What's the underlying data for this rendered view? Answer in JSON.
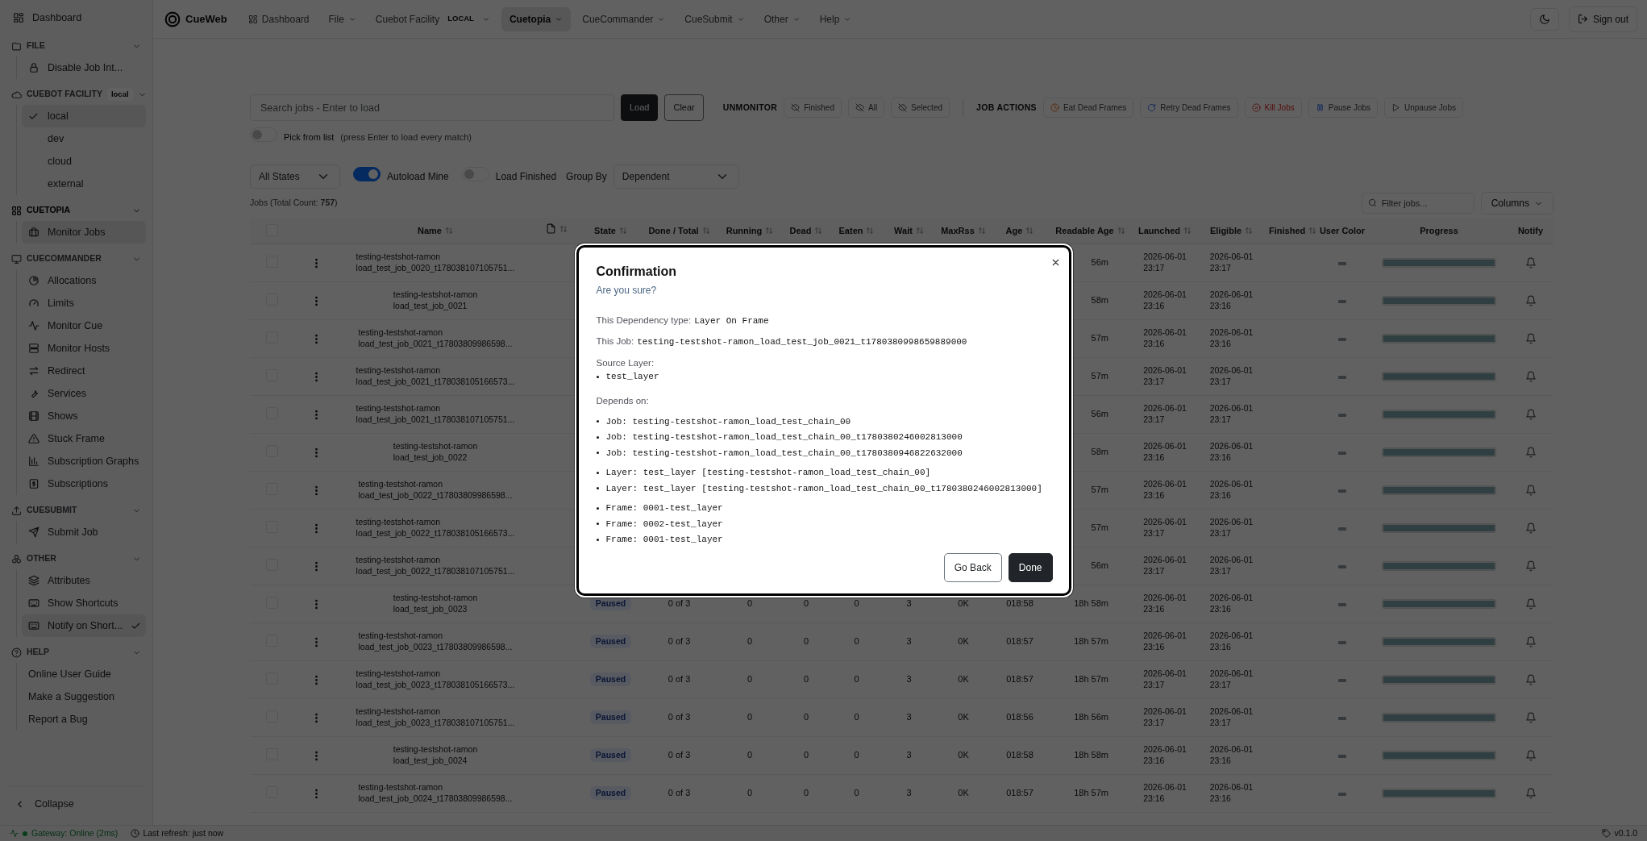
{
  "topbar": {
    "brand": "CueWeb",
    "nav": [
      {
        "label": "Dashboard",
        "kind": "link",
        "selected": false
      },
      {
        "label": "File",
        "kind": "menu",
        "selected": false
      },
      {
        "label": "Cuebot Facility",
        "badge": "LOCAL",
        "kind": "menu",
        "selected": false
      },
      {
        "label": "Cuetopia",
        "kind": "menu",
        "selected": true
      },
      {
        "label": "CueCommander",
        "kind": "menu",
        "selected": false
      },
      {
        "label": "CueSubmit",
        "kind": "menu",
        "selected": false
      },
      {
        "label": "Other",
        "kind": "menu",
        "selected": false
      },
      {
        "label": "Help",
        "kind": "menu",
        "selected": false
      }
    ],
    "sign_out": "Sign out"
  },
  "sidebar": {
    "dashboard": "Dashboard",
    "sections": [
      {
        "title": "FILE",
        "expanded": true,
        "active": false,
        "items": [
          {
            "label": "Disable Job Int...",
            "selected": false
          }
        ]
      },
      {
        "title": "CUEBOT FACILITY",
        "badge": "local",
        "expanded": true,
        "active": false,
        "items": [
          {
            "label": "local",
            "selected": true,
            "checked": true
          },
          {
            "label": "dev",
            "selected": false,
            "checked": false
          },
          {
            "label": "cloud",
            "selected": false,
            "checked": false
          },
          {
            "label": "external",
            "selected": false,
            "checked": false
          }
        ]
      },
      {
        "title": "CUETOPIA",
        "expanded": true,
        "active": true,
        "items": [
          {
            "label": "Monitor Jobs",
            "selected": true
          }
        ]
      },
      {
        "title": "CUECOMMANDER",
        "expanded": true,
        "active": false,
        "items": [
          {
            "label": "Allocations",
            "selected": false
          },
          {
            "label": "Limits",
            "selected": false
          },
          {
            "label": "Monitor Cue",
            "selected": false
          },
          {
            "label": "Monitor Hosts",
            "selected": false
          },
          {
            "label": "Redirect",
            "selected": false
          },
          {
            "label": "Services",
            "selected": false
          },
          {
            "label": "Shows",
            "selected": false
          },
          {
            "label": "Stuck Frame",
            "selected": false
          },
          {
            "label": "Subscription Graphs",
            "selected": false
          },
          {
            "label": "Subscriptions",
            "selected": false
          }
        ]
      },
      {
        "title": "CUESUBMIT",
        "expanded": true,
        "active": false,
        "items": [
          {
            "label": "Submit Job",
            "selected": false
          }
        ]
      },
      {
        "title": "OTHER",
        "expanded": true,
        "active": false,
        "items": [
          {
            "label": "Attributes",
            "selected": false
          },
          {
            "label": "Show Shortcuts",
            "selected": false
          },
          {
            "label": "Notify on Short...",
            "selected": true,
            "checked": true
          }
        ]
      },
      {
        "title": "HELP",
        "expanded": true,
        "active": false,
        "items": [
          {
            "label": "Online User Guide",
            "selected": false
          },
          {
            "label": "Make a Suggestion",
            "selected": false
          },
          {
            "label": "Report a Bug",
            "selected": false
          }
        ]
      }
    ],
    "collapse": "Collapse"
  },
  "toolbar": {
    "search_placeholder": "Search jobs - Enter to load",
    "load": "Load",
    "clear": "Clear",
    "unmonitor_label": "UNMONITOR",
    "unmonitor": [
      "Finished",
      "All",
      "Selected"
    ],
    "actions_label": "JOB ACTIONS",
    "actions": [
      {
        "label": "Eat Dead Frames",
        "kind": "eat"
      },
      {
        "label": "Retry Dead Frames",
        "kind": "retry"
      },
      {
        "label": "Kill Jobs",
        "kind": "kill"
      },
      {
        "label": "Pause Jobs",
        "kind": "pause"
      },
      {
        "label": "Unpause Jobs",
        "kind": "unpause"
      }
    ],
    "pick_from_list": {
      "on": false,
      "label": "Pick from list",
      "hint": "(press Enter to load every match)"
    }
  },
  "filters": {
    "state": "All States",
    "autoload_mine": {
      "label": "Autoload Mine",
      "on": true
    },
    "load_finished": {
      "label": "Load Finished",
      "on": false
    },
    "group_by_label": "Group By",
    "group_by": "Dependent"
  },
  "jobs": {
    "count": "Jobs (Total Count: **757**)",
    "filter_placeholder": "Filter jobs...",
    "columns_button": "Columns"
  },
  "table": {
    "header_checked": false,
    "columns": [
      {
        "label": "Name",
        "sortable": true
      },
      {
        "kind": "icon",
        "sortable": true
      },
      {
        "label": "State",
        "sortable": true
      },
      {
        "label": "Done / Total",
        "sortable": true
      },
      {
        "label": "Running",
        "sortable": true
      },
      {
        "label": "Dead",
        "sortable": true
      },
      {
        "label": "Eaten",
        "sortable": true
      },
      {
        "label": "Wait",
        "sortable": true
      },
      {
        "label": "MaxRss",
        "sortable": true
      },
      {
        "label": "Age",
        "sortable": true
      },
      {
        "label": "Readable Age",
        "sortable": true
      },
      {
        "label": "Launched",
        "sortable": true
      },
      {
        "label": "Eligible",
        "sortable": true
      },
      {
        "label": "Finished",
        "sortable": true
      },
      {
        "label": "User Color",
        "sortable": false
      },
      {
        "label": "Progress",
        "sortable": false
      },
      {
        "label": "Notify",
        "sortable": false
      }
    ],
    "rows": [
      {
        "checked": false,
        "name": "testing-testshot-ramon\nload_test_job_0020_t178038107105751...",
        "readable_age": "56m",
        "launched": "2026-06-01\n23:17",
        "eligible": "2026-06-01\n23:17",
        "level": 1
      },
      {
        "checked": false,
        "name": "testing-testshot-ramon\nload_test_job_0021",
        "readable_age": "58m",
        "launched": "2026-06-01\n23:16",
        "eligible": "2026-06-01\n23:16",
        "level": 1
      },
      {
        "checked": false,
        "name": "testing-testshot-ramon\nload_test_job_0021_t17803809986598...",
        "readable_age": "57m",
        "launched": "2026-06-01\n23:16",
        "eligible": "2026-06-01\n23:16",
        "level": 1
      },
      {
        "checked": false,
        "name": "testing-testshot-ramon\nload_test_job_0021_t178038105166573...",
        "readable_age": "57m",
        "launched": "2026-06-01\n23:17",
        "eligible": "2026-06-01\n23:17",
        "level": 1
      },
      {
        "checked": false,
        "name": "testing-testshot-ramon\nload_test_job_0021_t178038107105751...",
        "readable_age": "56m",
        "launched": "2026-06-01\n23:17",
        "eligible": "2026-06-01\n23:17",
        "level": 1
      },
      {
        "checked": false,
        "name": "testing-testshot-ramon\nload_test_job_0022",
        "readable_age": "58m",
        "launched": "2026-06-01\n23:16",
        "eligible": "2026-06-01\n23:16",
        "level": 1
      },
      {
        "checked": false,
        "name": "testing-testshot-ramon\nload_test_job_0022_t17803809986598...",
        "readable_age": "57m",
        "launched": "2026-06-01\n23:16",
        "eligible": "2026-06-01\n23:16",
        "level": 1
      },
      {
        "checked": false,
        "name": "testing-testshot-ramon\nload_test_job_0022_t178038105166573...",
        "readable_age": "57m",
        "launched": "2026-06-01\n23:17",
        "eligible": "2026-06-01\n23:17",
        "level": 1
      },
      {
        "checked": false,
        "name": "testing-testshot-ramon\nload_test_job_0022_t178038107105751...",
        "readable_age": "56m",
        "launched": "2026-06-01\n23:17",
        "eligible": "2026-06-01\n23:17",
        "level": 1
      },
      {
        "checked": false,
        "name": "testing-testshot-ramon\nload_test_job_0023",
        "state": "Paused",
        "done": "0 of 3",
        "running": "0",
        "dead": "0",
        "eaten": "0",
        "wait": "3",
        "maxrss": "0K",
        "age": "018:58",
        "readable_age": "18h 58m",
        "launched": "2026-06-01\n23:16",
        "eligible": "2026-06-01\n23:16",
        "level": 1
      },
      {
        "checked": false,
        "name": "testing-testshot-ramon\nload_test_job_0023_t17803809986598...",
        "state": "Paused",
        "done": "0 of 3",
        "running": "0",
        "dead": "0",
        "eaten": "0",
        "wait": "3",
        "maxrss": "0K",
        "age": "018:57",
        "readable_age": "18h 57m",
        "launched": "2026-06-01\n23:16",
        "eligible": "2026-06-01\n23:16",
        "level": 1
      },
      {
        "checked": false,
        "name": "testing-testshot-ramon\nload_test_job_0023_t178038105166573...",
        "state": "Paused",
        "done": "0 of 3",
        "running": "0",
        "dead": "0",
        "eaten": "0",
        "wait": "3",
        "maxrss": "0K",
        "age": "018:57",
        "readable_age": "18h 57m",
        "launched": "2026-06-01\n23:17",
        "eligible": "2026-06-01\n23:17",
        "level": 1
      },
      {
        "checked": false,
        "name": "testing-testshot-ramon\nload_test_job_0023_t178038107105751...",
        "state": "Paused",
        "done": "0 of 3",
        "running": "0",
        "dead": "0",
        "eaten": "0",
        "wait": "3",
        "maxrss": "0K",
        "age": "018:56",
        "readable_age": "18h 56m",
        "launched": "2026-06-01\n23:17",
        "eligible": "2026-06-01\n23:17",
        "level": 1
      },
      {
        "checked": false,
        "name": "testing-testshot-ramon\nload_test_job_0024",
        "state": "Paused",
        "done": "0 of 3",
        "running": "0",
        "dead": "0",
        "eaten": "0",
        "wait": "3",
        "maxrss": "0K",
        "age": "018:58",
        "readable_age": "18h 58m",
        "launched": "2026-06-01\n23:16",
        "eligible": "2026-06-01\n23:16",
        "level": 1
      },
      {
        "checked": false,
        "name": "testing-testshot-ramon\nload_test_job_0024_t17803809986598...",
        "state": "Paused",
        "done": "0 of 3",
        "running": "0",
        "dead": "0",
        "eaten": "0",
        "wait": "3",
        "maxrss": "0K",
        "age": "018:57",
        "readable_age": "18h 57m",
        "launched": "2026-06-01\n23:16",
        "eligible": "2026-06-01\n23:16",
        "level": 1
      }
    ]
  },
  "status_bar": {
    "online": true,
    "gateway": "Gateway: Online (2ms)",
    "refresh": "Last refresh: just now",
    "version": "v0.1.0"
  },
  "modal": {
    "title": "Confirmation",
    "subtitle": "Are you sure?",
    "dependency_label": "This Dependency type:",
    "dependency_type": "Layer On Frame",
    "job_label": "This Job:",
    "job": "testing-testshot-ramon_load_test_job_0021_t1780380998659889000",
    "source_label": "Source Layer:",
    "source_layers": [
      "test_layer"
    ],
    "depends_label": "Depends on:",
    "depends_on": [
      {
        "items": [
          "Job: testing-testshot-ramon_load_test_chain_00",
          "Job: testing-testshot-ramon_load_test_chain_00_t1780380246002813000",
          "Job: testing-testshot-ramon_load_test_chain_00_t1780380946822632000"
        ]
      },
      {
        "items": [
          "Layer: test_layer [testing-testshot-ramon_load_test_chain_00]",
          "Layer: test_layer [testing-testshot-ramon_load_test_chain_00_t1780380246002813000]"
        ]
      },
      {
        "items": [
          "Frame: 0001-test_layer",
          "Frame: 0002-test_layer",
          "Frame: 0001-test_layer"
        ]
      }
    ],
    "back": "Go Back",
    "done": "Done"
  }
}
